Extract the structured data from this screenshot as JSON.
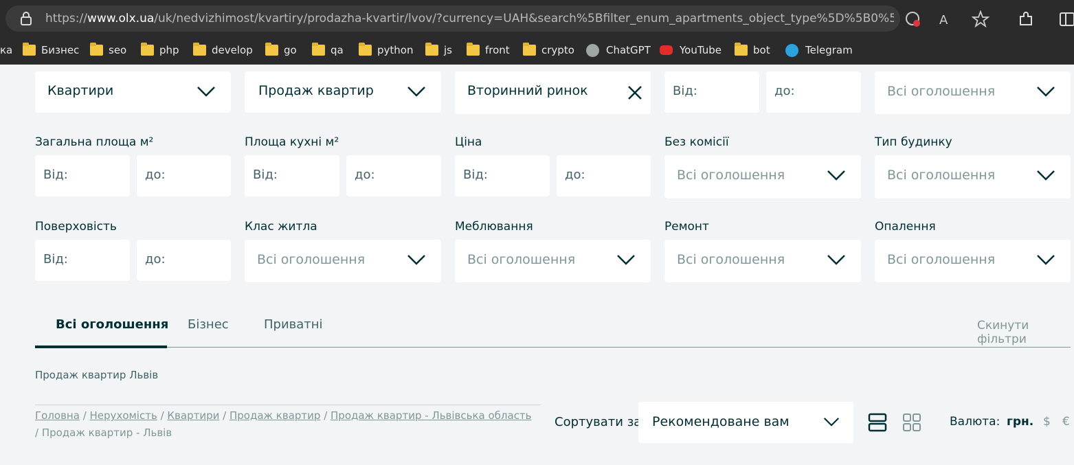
{
  "browser": {
    "url_prefix": "https://",
    "url_domain": "www.olx.ua",
    "url_rest": "/uk/nedvizhimost/kvartiry/prodazha-kvartir/lvov/?currency=UAH&search%5Bfilter_enum_apartments_object_type%5D%5B0%5D=secondar...",
    "bookmarks": [
      {
        "label": "ка",
        "icon": "none"
      },
      {
        "label": "Бизнес",
        "icon": "folder-icon"
      },
      {
        "label": "seo",
        "icon": "folder-icon"
      },
      {
        "label": "php",
        "icon": "folder-icon"
      },
      {
        "label": "develop",
        "icon": "folder-icon"
      },
      {
        "label": "go",
        "icon": "folder-icon"
      },
      {
        "label": "qa",
        "icon": "folder-icon"
      },
      {
        "label": "python",
        "icon": "folder-icon"
      },
      {
        "label": "js",
        "icon": "folder-icon"
      },
      {
        "label": "front",
        "icon": "folder-icon"
      },
      {
        "label": "crypto",
        "icon": "folder-icon"
      },
      {
        "label": "ChatGPT",
        "icon": "chatgpt-icon"
      },
      {
        "label": "YouTube",
        "icon": "youtube-icon"
      },
      {
        "label": "bot",
        "icon": "folder-icon"
      },
      {
        "label": "Telegram",
        "icon": "telegram-icon"
      }
    ]
  },
  "filters": {
    "category": "Квартири",
    "subcategory": "Продаж квартир",
    "market": "Вторинний ринок",
    "floor_from": "Від:",
    "floor_to": "до:",
    "top_select": "Всі оголошення",
    "total_area": {
      "label": "Загальна площа м²",
      "from": "Від:",
      "to": "до:"
    },
    "kitchen_area": {
      "label": "Площа кухні м²",
      "from": "Від:",
      "to": "до:"
    },
    "price": {
      "label": "Ціна",
      "from": "Від:",
      "to": "до:"
    },
    "no_commission": {
      "label": "Без комісії",
      "value": "Всі оголошення"
    },
    "building_type": {
      "label": "Тип будинку",
      "value": "Всі оголошення"
    },
    "floors": {
      "label": "Поверховість",
      "from": "Від:",
      "to": "до:"
    },
    "housing_class": {
      "label": "Клас житла",
      "value": "Всі оголошення"
    },
    "furnishing": {
      "label": "Меблювання",
      "value": "Всі оголошення"
    },
    "renovation": {
      "label": "Ремонт",
      "value": "Всі оголошення"
    },
    "heating": {
      "label": "Опалення",
      "value": "Всі оголошення"
    }
  },
  "tabs": {
    "all": "Всі оголошення",
    "business": "Бізнес",
    "private": "Приватні",
    "reset": "Скинути фільтри"
  },
  "page_heading": "Продаж квартир Львів",
  "breadcrumbs": {
    "items": [
      "Головна",
      "Нерухомість",
      "Квартири",
      "Продаж квартир",
      "Продаж квартир - Львівська область"
    ],
    "sep": " / ",
    "current": "Продаж квартир - Львів"
  },
  "sort": {
    "label": "Сортувати за:",
    "value": "Рекомендоване вам"
  },
  "currency": {
    "label": "Валюта:",
    "uah": "грн.",
    "usd": "$",
    "eur": "€"
  },
  "colors": {
    "primary": "#002f34",
    "muted": "#7f9799",
    "background": "#f2f4f5"
  }
}
